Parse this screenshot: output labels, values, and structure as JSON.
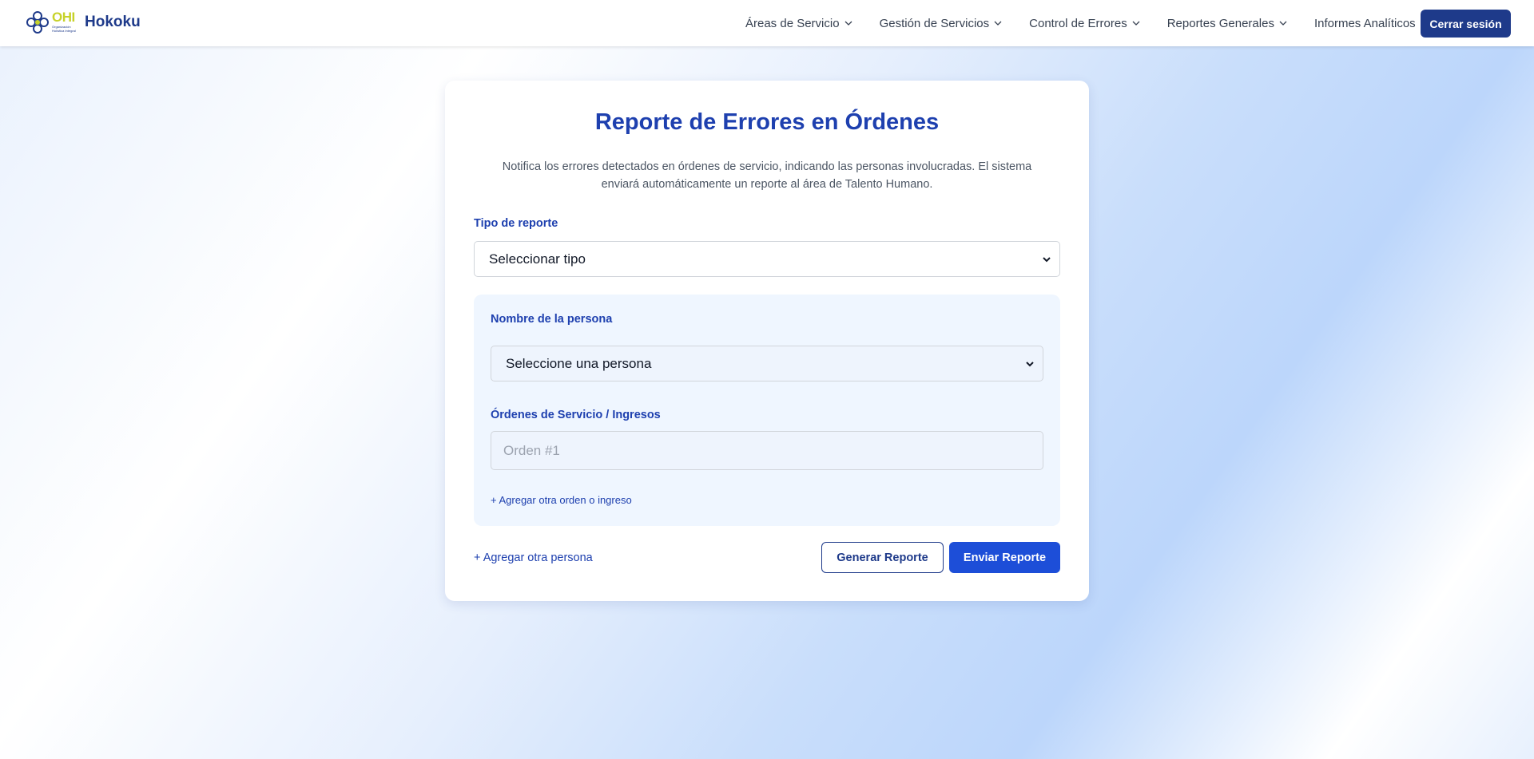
{
  "header": {
    "logo_text": "OHI",
    "logo_subtext": "Organización Holística Integral",
    "brand_name": "Hokoku",
    "nav": [
      {
        "label": "Áreas de Servicio"
      },
      {
        "label": "Gestión de Servicios"
      },
      {
        "label": "Control de Errores"
      },
      {
        "label": "Reportes Generales"
      },
      {
        "label": "Informes Analíticos"
      }
    ],
    "logout_label": "Cerrar sesión"
  },
  "form": {
    "title": "Reporte de Errores en Órdenes",
    "description": "Notifica los errores detectados en órdenes de servicio, indicando las personas involucradas. El sistema enviará automáticamente un reporte al área de Talento Humano.",
    "report_type_label": "Tipo de reporte",
    "report_type_value": "Seleccionar tipo",
    "person": {
      "name_label": "Nombre de la persona",
      "name_value": "Seleccione una persona",
      "orders_label": "Órdenes de Servicio / Ingresos",
      "order_placeholder": "Orden #1",
      "add_order_label": "+ Agregar otra orden o ingreso"
    },
    "add_person_label": "+ Agregar otra persona",
    "generate_label": "Generar Reporte",
    "send_label": "Enviar Reporte"
  },
  "colors": {
    "brand_dark": "#1e3a8a",
    "primary": "#1d4ed8",
    "logo_accent": "#c7d22a"
  }
}
